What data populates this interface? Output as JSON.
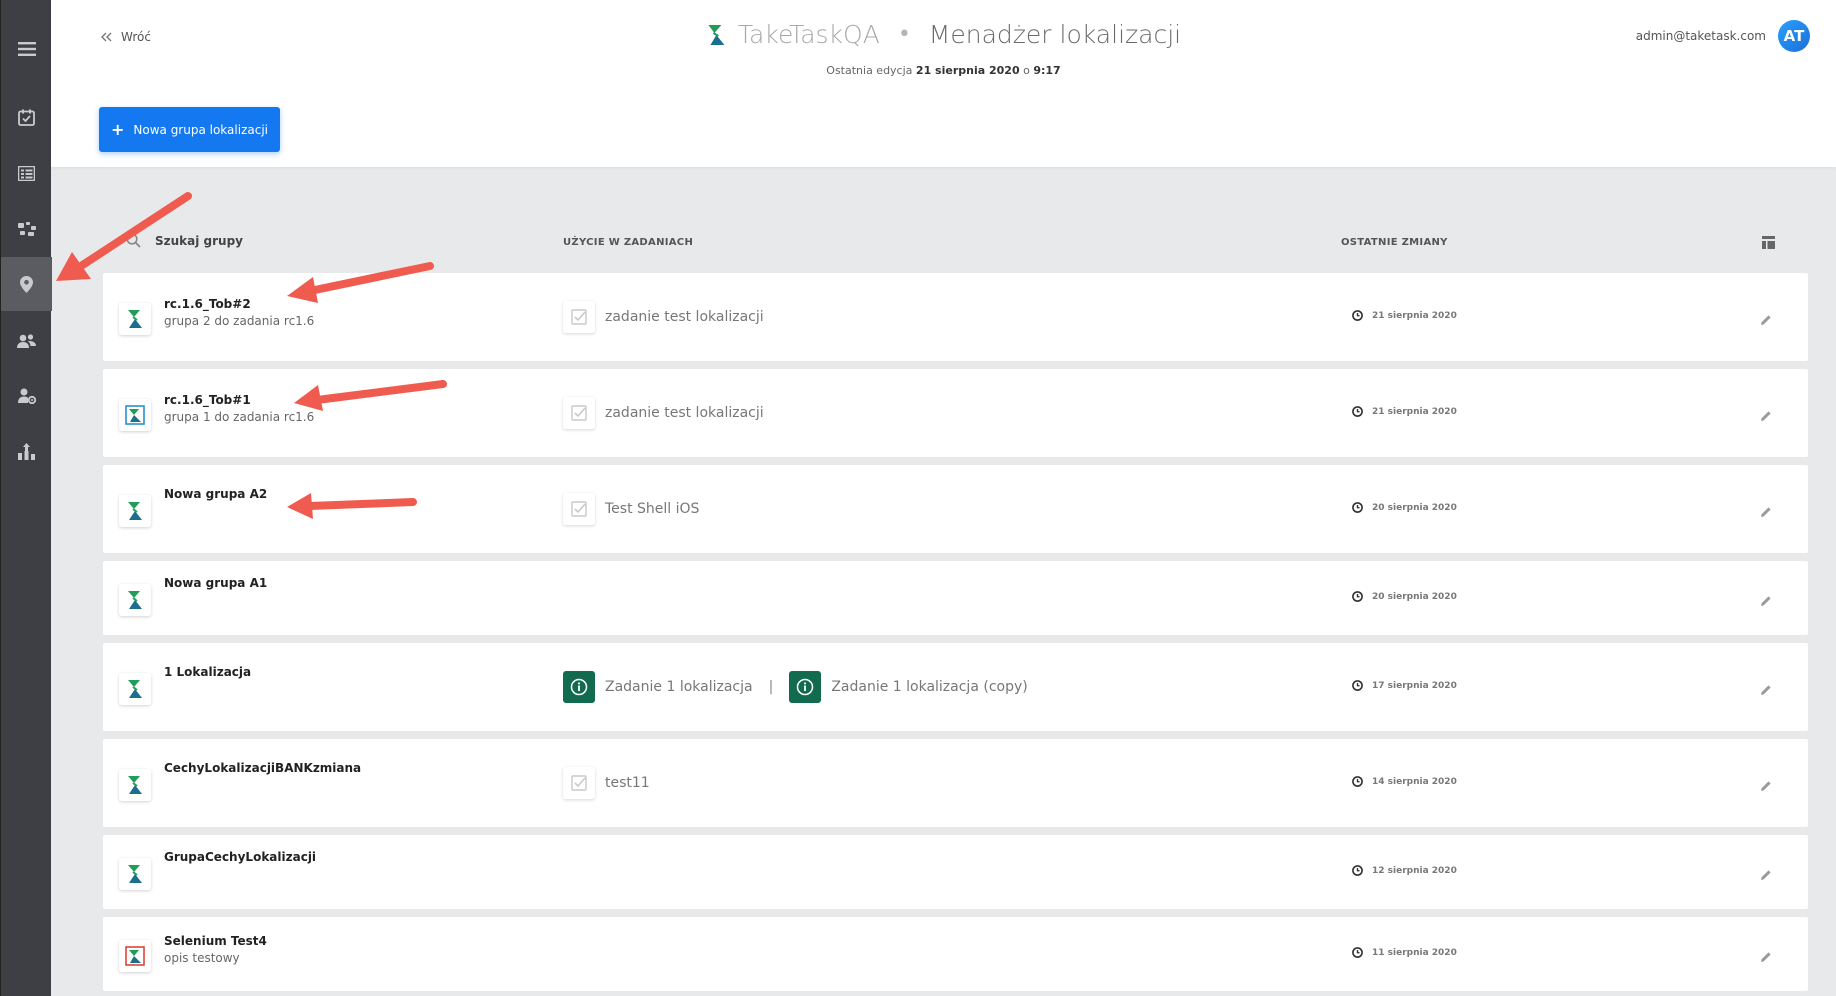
{
  "sidebar": {
    "items": [
      {
        "icon": "menu-icon"
      },
      {
        "icon": "task-check-icon"
      },
      {
        "icon": "list-icon"
      },
      {
        "icon": "diagram-icon"
      },
      {
        "icon": "location-pin-icon",
        "active": true
      },
      {
        "icon": "users-icon"
      },
      {
        "icon": "user-settings-icon"
      },
      {
        "icon": "stats-icon"
      }
    ]
  },
  "header": {
    "back_label": "Wróć",
    "app_name": "TakeTaskQA",
    "separator": "•",
    "page_title": "Menadżer lokalizacji",
    "last_edit_prefix": "Ostatnia edycja",
    "last_edit_date": "21 sierpnia 2020",
    "last_edit_joiner": "o",
    "last_edit_time": "9:17",
    "user_email": "admin@taketask.com",
    "user_initials": "AT",
    "new_group_label": "Nowa grupa lokalizacji",
    "new_group_plus": "+"
  },
  "table": {
    "search_placeholder": "Szukaj grupy",
    "col_usage": "UŻYCIE W ZADANIACH",
    "col_changes": "OSTATNIE ZMIANY",
    "rows": [
      {
        "name": "rc.1.6_Tob#2",
        "desc": "grupa 2 do zadania rc1.6",
        "logo": "green",
        "tasks": [
          {
            "label": "zadanie test lokalizacji",
            "icon": "check"
          }
        ],
        "date": "21 sierpnia 2020"
      },
      {
        "name": "rc.1.6_Tob#1",
        "desc": "grupa 1 do zadania rc1.6",
        "logo": "blue-frame",
        "tasks": [
          {
            "label": "zadanie test lokalizacji",
            "icon": "check"
          }
        ],
        "date": "21 sierpnia 2020"
      },
      {
        "name": "Nowa grupa A2",
        "desc": "",
        "logo": "green",
        "tasks": [
          {
            "label": "Test Shell iOS",
            "icon": "check"
          }
        ],
        "date": "20 sierpnia 2020"
      },
      {
        "name": "Nowa grupa A1",
        "desc": "",
        "logo": "green",
        "tasks": [],
        "date": "20 sierpnia 2020"
      },
      {
        "name": "1 Lokalizacja",
        "desc": "",
        "logo": "green",
        "tasks": [
          {
            "label": "Zadanie 1 lokalizacja",
            "icon": "info"
          },
          {
            "label": "Zadanie 1 lokalizacja (copy)",
            "icon": "info"
          }
        ],
        "task_separator": "|",
        "date": "17 sierpnia 2020"
      },
      {
        "name": "CechyLokalizacjiBANKzmiana",
        "desc": "",
        "logo": "green",
        "tasks": [
          {
            "label": "test11",
            "icon": "check"
          }
        ],
        "date": "14 sierpnia 2020"
      },
      {
        "name": "GrupaCechyLokalizacji",
        "desc": "",
        "logo": "green",
        "tasks": [],
        "date": "12 sierpnia 2020"
      },
      {
        "name": "Selenium Test4",
        "desc": "opis testowy",
        "logo": "red-frame",
        "tasks": [],
        "date": "11 sierpnia 2020"
      }
    ]
  },
  "colors": {
    "primary": "#1478f0",
    "sidebar_bg": "#3d3f44",
    "sidebar_active": "#5a5c61",
    "info_task": "#126b4f",
    "arrow": "#ef5b4f",
    "brand_green": "#1f9e57",
    "brand_teal": "#1c6f8c"
  }
}
